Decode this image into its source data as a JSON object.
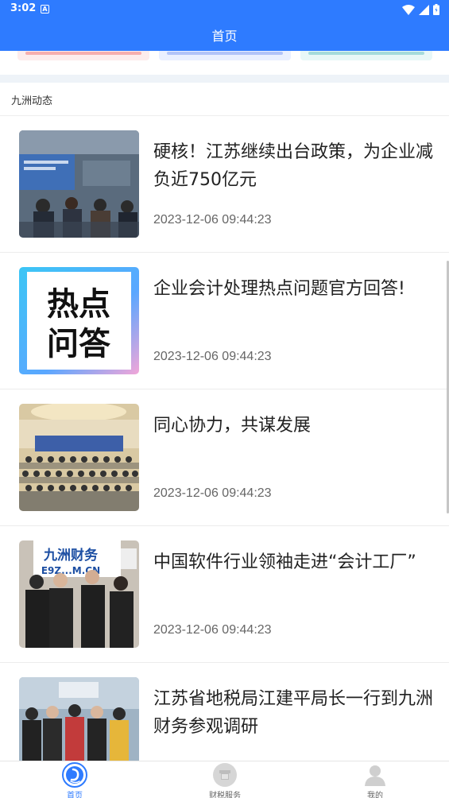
{
  "status_bar": {
    "time": "3:02",
    "notification_icon": "A"
  },
  "header": {
    "title": "首页"
  },
  "section": {
    "title": "九洲动态"
  },
  "news": [
    {
      "title": "硬核！江苏继续出台政策，为企业减负近750亿元",
      "date": "2023-12-06 09:44:23"
    },
    {
      "title": "企业会计处理热点问题官方回答!",
      "date": "2023-12-06 09:44:23",
      "thumb_text_line1": "热点",
      "thumb_text_line2": "问答"
    },
    {
      "title": "同心协力，共谋发展",
      "date": "2023-12-06 09:44:23"
    },
    {
      "title": "中国软件行业领袖走进“会计工厂”",
      "date": "2023-12-06 09:44:23",
      "thumb_sign": "九洲财务",
      "thumb_sign2": "E9Z...M.CN"
    },
    {
      "title": "江苏省地税局江建平局长一行到九洲财务参观调研",
      "date": ""
    }
  ],
  "tabs": [
    {
      "label": "首页",
      "icon": "home-icon",
      "active": true
    },
    {
      "label": "财税服务",
      "icon": "service-icon",
      "active": false
    },
    {
      "label": "我的",
      "icon": "profile-icon",
      "active": false
    }
  ],
  "colors": {
    "primary": "#2e7bff",
    "background": "#ffffff",
    "band": "#eef3f8"
  }
}
